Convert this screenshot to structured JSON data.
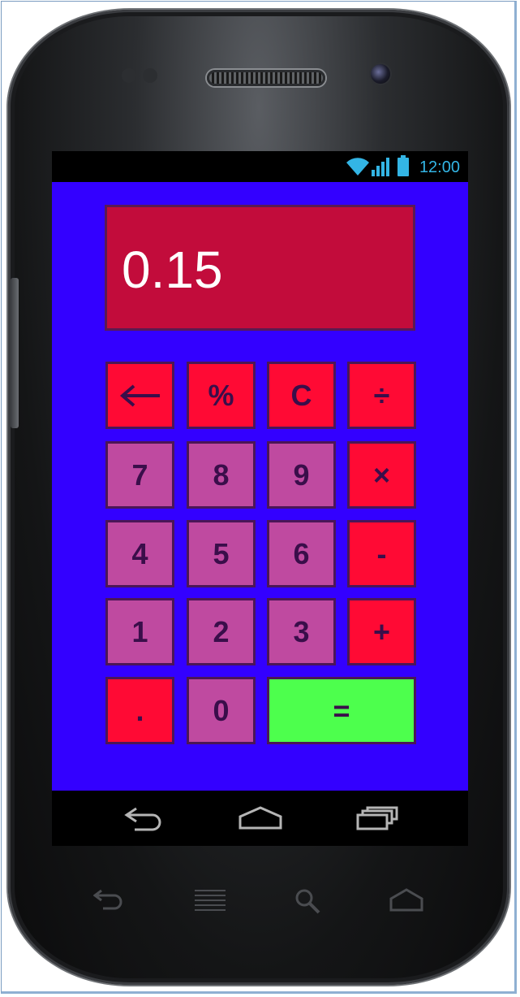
{
  "status_bar": {
    "time": "12:00",
    "icons": [
      "wifi-icon",
      "signal-icon",
      "battery-icon"
    ],
    "accent_color": "#33b5e5"
  },
  "calculator": {
    "display_value": "0.15",
    "colors": {
      "background": "#3300ff",
      "display": "#c20c3b",
      "operator_button": "#ff0a34",
      "digit_button": "#bf4aa0",
      "equals_button": "#4dff4d",
      "button_text": "#3a0e4a"
    },
    "buttons": {
      "backspace": "←",
      "percent": "%",
      "clear": "C",
      "divide": "÷",
      "seven": "7",
      "eight": "8",
      "nine": "9",
      "multiply": "×",
      "four": "4",
      "five": "5",
      "six": "6",
      "subtract": "-",
      "one": "1",
      "two": "2",
      "three": "3",
      "add": "+",
      "decimal": ".",
      "zero": "0",
      "equals": "="
    }
  },
  "nav_bar": {
    "icons": [
      "back-icon",
      "home-icon",
      "recent-apps-icon"
    ]
  },
  "hardware_keys": {
    "icons": [
      "back-icon",
      "menu-icon",
      "search-icon",
      "home-icon"
    ]
  }
}
